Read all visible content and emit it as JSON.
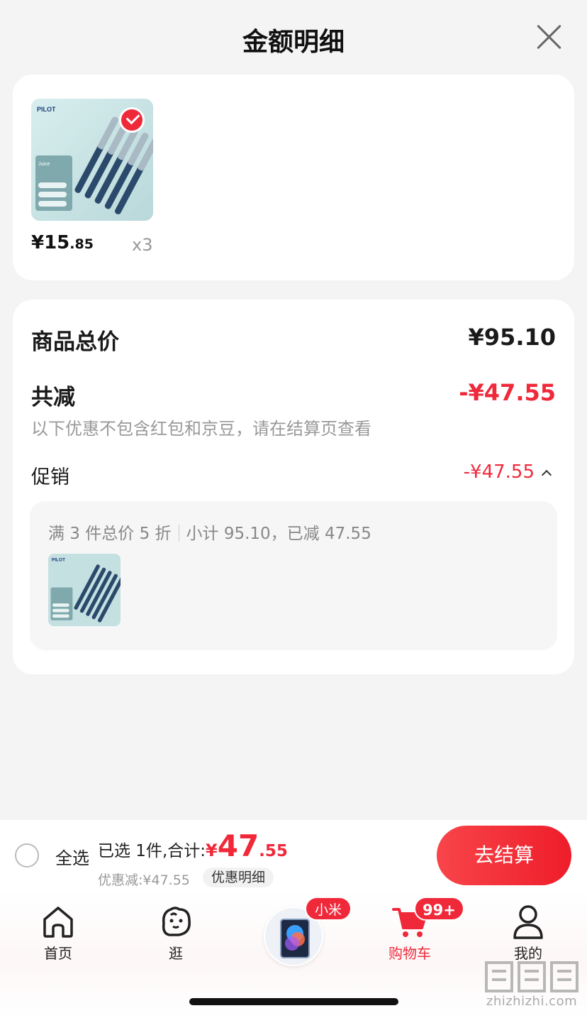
{
  "header": {
    "title": "金额明细",
    "close_icon": "close-icon"
  },
  "product": {
    "price_int": "¥15",
    "price_dec": ".85",
    "quantity": "x3",
    "selected": true
  },
  "summary": {
    "total_label": "商品总价",
    "total_value": "¥95.10",
    "discount_label": "共减",
    "discount_value": "-¥47.55",
    "note": "以下优惠不包含红包和京豆，请在结算页查看",
    "promo_label": "促销",
    "promo_value": "-¥47.55",
    "promo_rule": "满 3 件总价 5 折",
    "promo_subtotal": "小计 95.10，已减 47.55"
  },
  "bottom_bar": {
    "select_all": "全选",
    "selected_text": "已选 1件,合计:",
    "total_currency": "¥",
    "total_int": "47",
    "total_dec": ".55",
    "saved_text": "优惠减:¥47.55",
    "detail_button": "优惠明细",
    "checkout_button": "去结算"
  },
  "tabbar": {
    "home": "首页",
    "browse": "逛",
    "promo_tag": "小米",
    "cart": "购物车",
    "cart_badge": "99+",
    "me": "我的"
  },
  "watermark": "zhizhizhi.com",
  "colors": {
    "accent": "#f0293a",
    "background": "#f4f4f4"
  }
}
